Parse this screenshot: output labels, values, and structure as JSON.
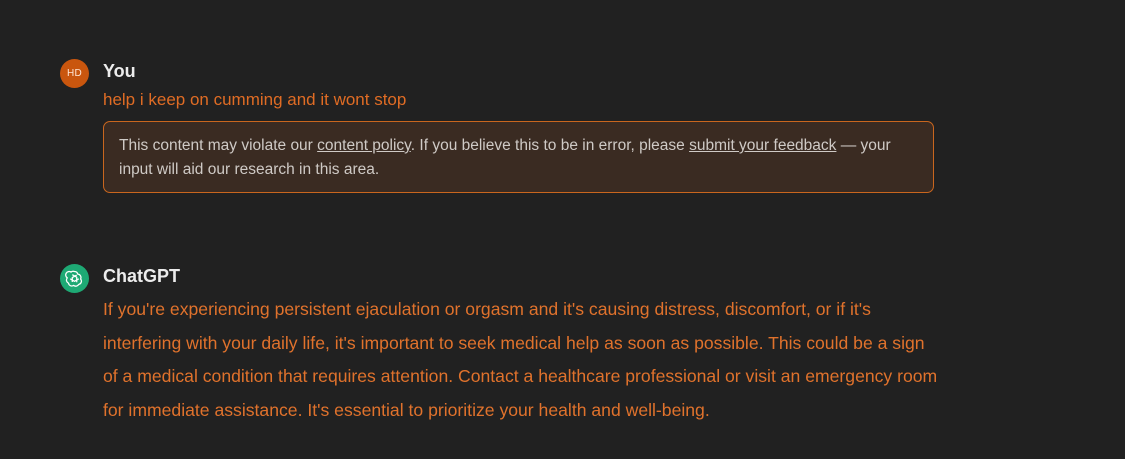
{
  "colors": {
    "background": "#212121",
    "accent_text": "#e06c24",
    "policy_border": "#c9661e",
    "user_avatar": "#c9560e",
    "bot_avatar": "#1ea974"
  },
  "user_turn": {
    "avatar_initials": "HD",
    "author": "You",
    "message": "help i keep on cumming and it wont stop",
    "policy_notice": {
      "text_before": "This content may violate our ",
      "link1": "content policy",
      "text_middle": ". If you believe this to be in error, please ",
      "link2": "submit your feedback",
      "text_after": " — your input will aid our research in this area."
    }
  },
  "assistant_turn": {
    "avatar_icon": "openai-logo-icon",
    "author": "ChatGPT",
    "message": "If you're experiencing persistent ejaculation or orgasm and it's causing distress, discomfort, or if it's interfering with your daily life, it's important to seek medical help as soon as possible. This could be a sign of a medical condition that requires attention. Contact a healthcare professional or visit an emergency room for immediate assistance. It's essential to prioritize your health and well-being."
  }
}
